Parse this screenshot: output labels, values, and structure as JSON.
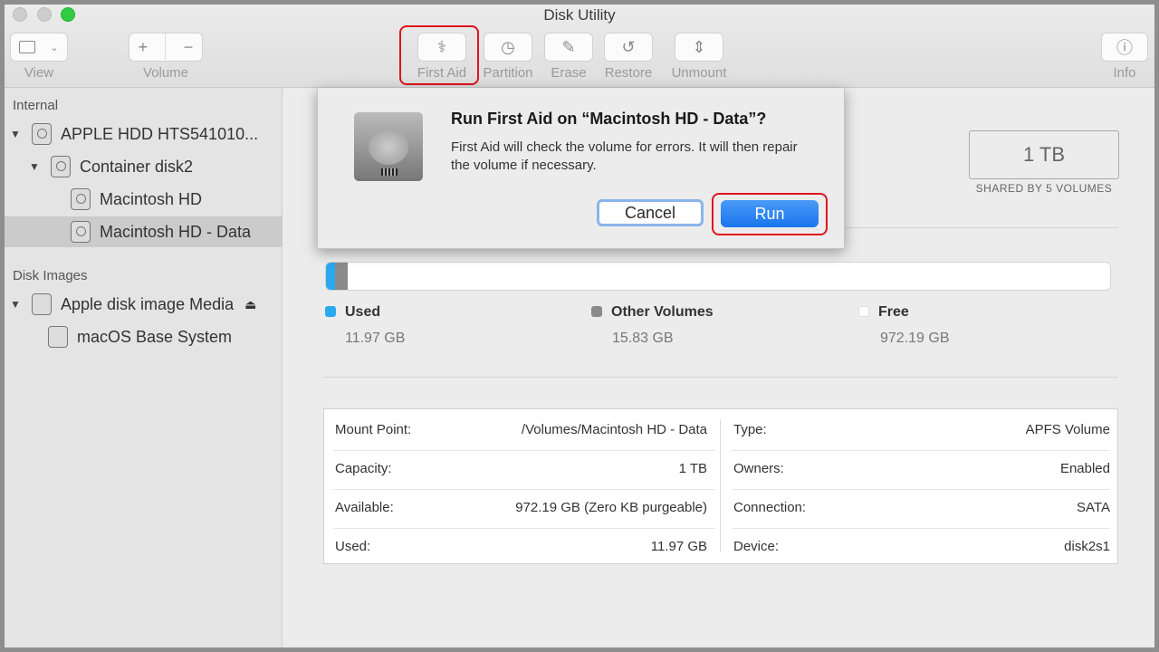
{
  "window": {
    "title": "Disk Utility"
  },
  "toolbar": {
    "view": "View",
    "volume": "Volume",
    "first_aid": "First Aid",
    "partition": "Partition",
    "erase": "Erase",
    "restore": "Restore",
    "unmount": "Unmount",
    "info": "Info"
  },
  "sidebar": {
    "internal": "Internal",
    "disk_images": "Disk Images",
    "items": [
      {
        "label": "APPLE HDD HTS541010..."
      },
      {
        "label": "Container disk2"
      },
      {
        "label": "Macintosh HD"
      },
      {
        "label": "Macintosh HD - Data"
      },
      {
        "label": "Apple disk image Media"
      },
      {
        "label": "macOS Base System"
      }
    ]
  },
  "dialog": {
    "title": "Run First Aid on “Macintosh HD - Data”?",
    "message": "First Aid will check the volume for errors. It will then repair the volume if necessary.",
    "cancel": "Cancel",
    "run": "Run"
  },
  "capacity": {
    "value": "1 TB",
    "sub": "SHARED BY 5 VOLUMES"
  },
  "usage": {
    "used_label": "Used",
    "used": "11.97 GB",
    "other_label": "Other Volumes",
    "other": "15.83 GB",
    "free_label": "Free",
    "free": "972.19 GB",
    "used_fraction": 0.012,
    "other_fraction": 0.016,
    "colors": {
      "used": "#2aa8f0",
      "other": "#8a8a8a",
      "free": "#ffffff"
    }
  },
  "details": {
    "left": [
      [
        "Mount Point:",
        "/Volumes/Macintosh HD - Data"
      ],
      [
        "Capacity:",
        "1 TB"
      ],
      [
        "Available:",
        "972.19 GB (Zero KB purgeable)"
      ],
      [
        "Used:",
        "11.97 GB"
      ]
    ],
    "right": [
      [
        "Type:",
        "APFS Volume"
      ],
      [
        "Owners:",
        "Enabled"
      ],
      [
        "Connection:",
        "SATA"
      ],
      [
        "Device:",
        "disk2s1"
      ]
    ]
  }
}
